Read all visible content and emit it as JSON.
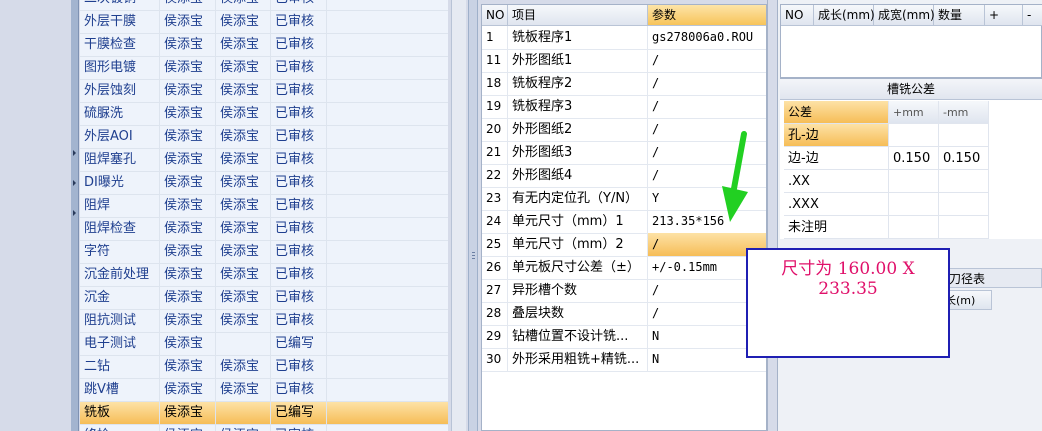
{
  "left_grid": {
    "rows": [
      {
        "name": "二次镀铜",
        "col2": "侯添宝",
        "col3": "侯添宝",
        "status": "已审核"
      },
      {
        "name": "外层干膜",
        "col2": "侯添宝",
        "col3": "侯添宝",
        "status": "已审核"
      },
      {
        "name": "干膜检查",
        "col2": "侯添宝",
        "col3": "侯添宝",
        "status": "已审核"
      },
      {
        "name": "图形电镀",
        "col2": "侯添宝",
        "col3": "侯添宝",
        "status": "已审核"
      },
      {
        "name": "外层蚀刻",
        "col2": "侯添宝",
        "col3": "侯添宝",
        "status": "已审核"
      },
      {
        "name": "硫脲洗",
        "col2": "侯添宝",
        "col3": "侯添宝",
        "status": "已审核"
      },
      {
        "name": "外层AOI",
        "col2": "侯添宝",
        "col3": "侯添宝",
        "status": "已审核"
      },
      {
        "name": "阻焊塞孔",
        "col2": "侯添宝",
        "col3": "侯添宝",
        "status": "已审核"
      },
      {
        "name": "DI曝光",
        "col2": "侯添宝",
        "col3": "侯添宝",
        "status": "已审核"
      },
      {
        "name": "阻焊",
        "col2": "侯添宝",
        "col3": "侯添宝",
        "status": "已审核"
      },
      {
        "name": "阻焊检查",
        "col2": "侯添宝",
        "col3": "侯添宝",
        "status": "已审核"
      },
      {
        "name": "字符",
        "col2": "侯添宝",
        "col3": "侯添宝",
        "status": "已审核"
      },
      {
        "name": "沉金前处理",
        "col2": "侯添宝",
        "col3": "侯添宝",
        "status": "已审核"
      },
      {
        "name": "沉金",
        "col2": "侯添宝",
        "col3": "侯添宝",
        "status": "已审核"
      },
      {
        "name": "阻抗测试",
        "col2": "侯添宝",
        "col3": "侯添宝",
        "status": "已审核"
      },
      {
        "name": "电子测试",
        "col2": "侯添宝",
        "col3": "",
        "status": "已编写"
      },
      {
        "name": "二钻",
        "col2": "侯添宝",
        "col3": "侯添宝",
        "status": "已审核"
      },
      {
        "name": "跳V槽",
        "col2": "侯添宝",
        "col3": "侯添宝",
        "status": "已审核"
      },
      {
        "name": "铣板",
        "col2": "侯添宝",
        "col3": "",
        "status": "已编写"
      },
      {
        "name": "终检",
        "col2": "侯添宝",
        "col3": "侯添宝",
        "status": "已审核"
      }
    ]
  },
  "param_grid": {
    "headers": {
      "no": "NO",
      "item": "项目",
      "param": "参数"
    },
    "rows": [
      {
        "no": "1",
        "item": "铣板程序1",
        "param": "gs278006a0.ROU"
      },
      {
        "no": "11",
        "item": "外形图纸1",
        "param": "/"
      },
      {
        "no": "18",
        "item": "铣板程序2",
        "param": "/"
      },
      {
        "no": "19",
        "item": "铣板程序3",
        "param": "/"
      },
      {
        "no": "20",
        "item": "外形图纸2",
        "param": "/"
      },
      {
        "no": "21",
        "item": "外形图纸3",
        "param": "/"
      },
      {
        "no": "22",
        "item": "外形图纸4",
        "param": "/"
      },
      {
        "no": "23",
        "item": "有无内定位孔（Y/N）",
        "param": "Y"
      },
      {
        "no": "24",
        "item": "单元尺寸（mm）1",
        "param": "213.35*156"
      },
      {
        "no": "25",
        "item": "单元尺寸（mm）2",
        "param": "/"
      },
      {
        "no": "26",
        "item": "单元板尺寸公差（±）",
        "param": "+/-0.15mm"
      },
      {
        "no": "27",
        "item": "异形槽个数",
        "param": "/"
      },
      {
        "no": "28",
        "item": "叠层块数",
        "param": "/"
      },
      {
        "no": "29",
        "item": "钻槽位置不设计铣...",
        "param": "N"
      },
      {
        "no": "30",
        "item": "外形采用粗铣+精铣...",
        "param": "N"
      }
    ]
  },
  "top_grid": {
    "headers": [
      "NO",
      "成长(mm)",
      "成宽(mm)",
      "数量",
      "+",
      "-"
    ]
  },
  "tolerance": {
    "title": "槽铣公差",
    "headers": {
      "name": "公差",
      "plus": "+mm",
      "minus": "-mm"
    },
    "rows": [
      {
        "name": "孔-边",
        "plus": "",
        "minus": ""
      },
      {
        "name": "边-边",
        "plus": "0.150",
        "minus": "0.150"
      },
      {
        "name": ".XX",
        "plus": "",
        "minus": ""
      },
      {
        "name": ".XXX",
        "plus": "",
        "minus": ""
      },
      {
        "name": "未注明",
        "plus": "",
        "minus": ""
      }
    ]
  },
  "knife": {
    "title": "刀径表",
    "header": "长(m)"
  },
  "annotation": {
    "line1": "尺寸为 160.00 X",
    "line2": "233.35"
  },
  "colors": {
    "accent_orange": "#f6bd57",
    "annotation_text": "#e0106a",
    "annotation_border": "#1f1fb3",
    "arrow": "#22d022"
  }
}
